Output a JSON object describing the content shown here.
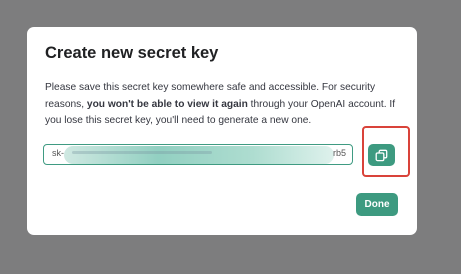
{
  "dialog": {
    "title": "Create new secret key",
    "description": {
      "part1": "Please save this secret key somewhere safe and accessible. For security reasons, ",
      "bold": "you won't be able to view it again",
      "part2": " through your OpenAI account. If you lose this secret key, you'll need to generate a new one."
    },
    "key_field": {
      "visible_prefix": "sk-",
      "visible_suffix": "rb5"
    },
    "copy_icon": "copy-icon",
    "done_label": "Done"
  },
  "colors": {
    "overlay": "#7d7d7e",
    "accent": "#3d9a80",
    "highlight": "#d9433a"
  }
}
